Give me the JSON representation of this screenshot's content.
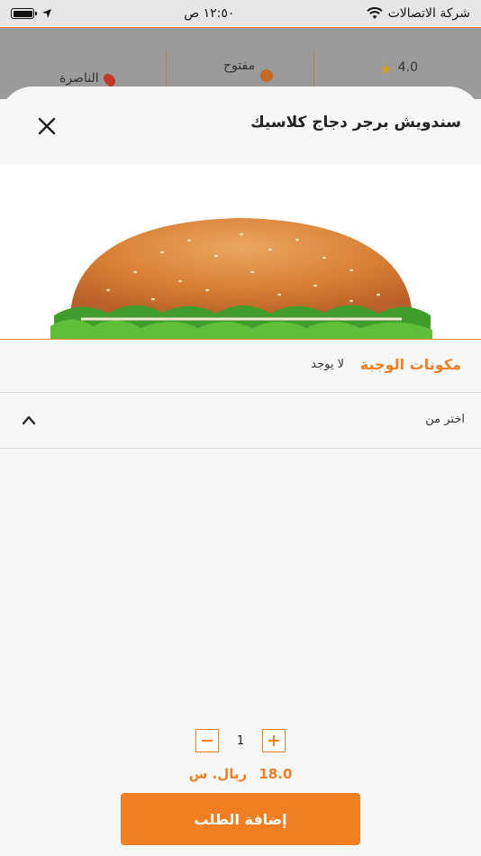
{
  "status_bar": {
    "carrier": "شركة الاتصالات",
    "time": "١٢:٥٠ ص"
  },
  "restaurant_info": {
    "rating": "4.0",
    "open_status": "مفتوح",
    "location": "الناصرة"
  },
  "item": {
    "title": "سندويش برجر دجاج كلاسيك",
    "ingredients_label": "مكونات الوجبة",
    "ingredients_value": "لا يوجد",
    "choose_label": "اختر من",
    "quantity": "1",
    "price_value": "18.0",
    "price_currency": "ريال. س",
    "add_button": "إضافة الطلب"
  },
  "colors": {
    "accent": "#f07f24"
  }
}
